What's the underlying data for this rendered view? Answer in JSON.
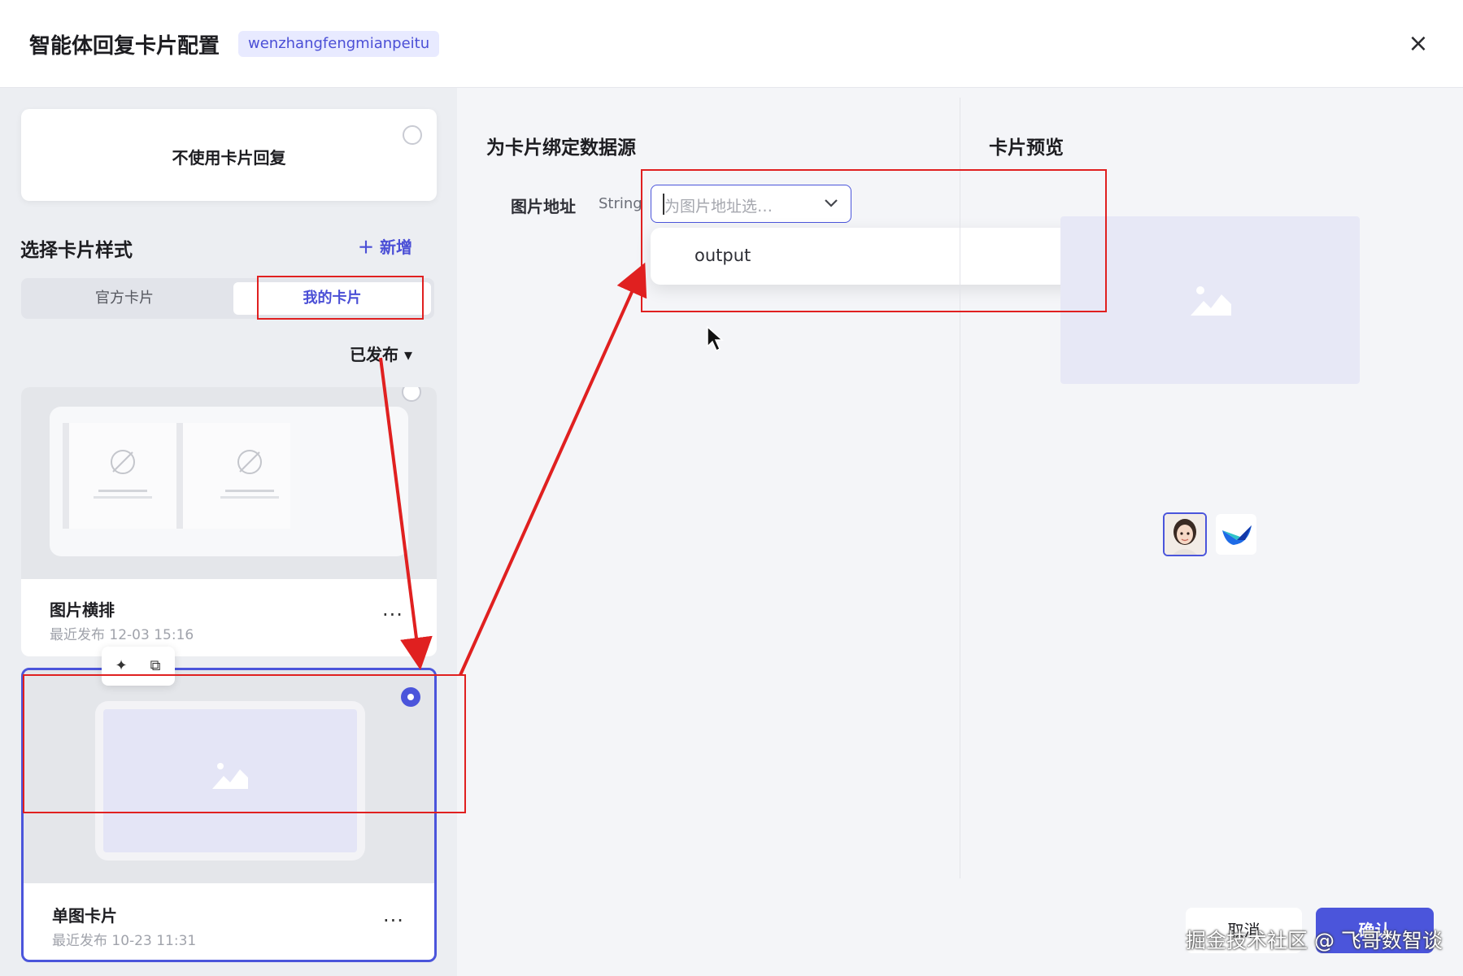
{
  "header": {
    "title": "智能体回复卡片配置",
    "tag": "wenzhangfengmianpeitu",
    "close_icon": "×"
  },
  "left": {
    "no_card_label": "不使用卡片回复",
    "section_title": "选择卡片样式",
    "add_label": "＋ 新增",
    "tabs": [
      "官方卡片",
      "我的卡片"
    ],
    "filter_label": "已发布 ▾",
    "cards": [
      {
        "name": "图片横排",
        "date": "最近发布 12-03 15:16",
        "more": "···"
      },
      {
        "name": "单图卡片",
        "date": "最近发布 10-23 11:31",
        "more": "···",
        "selected": true
      }
    ]
  },
  "binding": {
    "title": "为卡片绑定数据源",
    "field_label": "图片地址",
    "field_type": "String",
    "placeholder": "为图片地址选…",
    "options": [
      "output"
    ]
  },
  "preview": {
    "title": "卡片预览"
  },
  "footer": {
    "cancel_label": "取消",
    "ok_label": "确认",
    "watermark": "掘金技术社区 @ 飞哥数智谈"
  },
  "colors": {
    "accent": "#4b55db",
    "annotation": "#e02020"
  }
}
